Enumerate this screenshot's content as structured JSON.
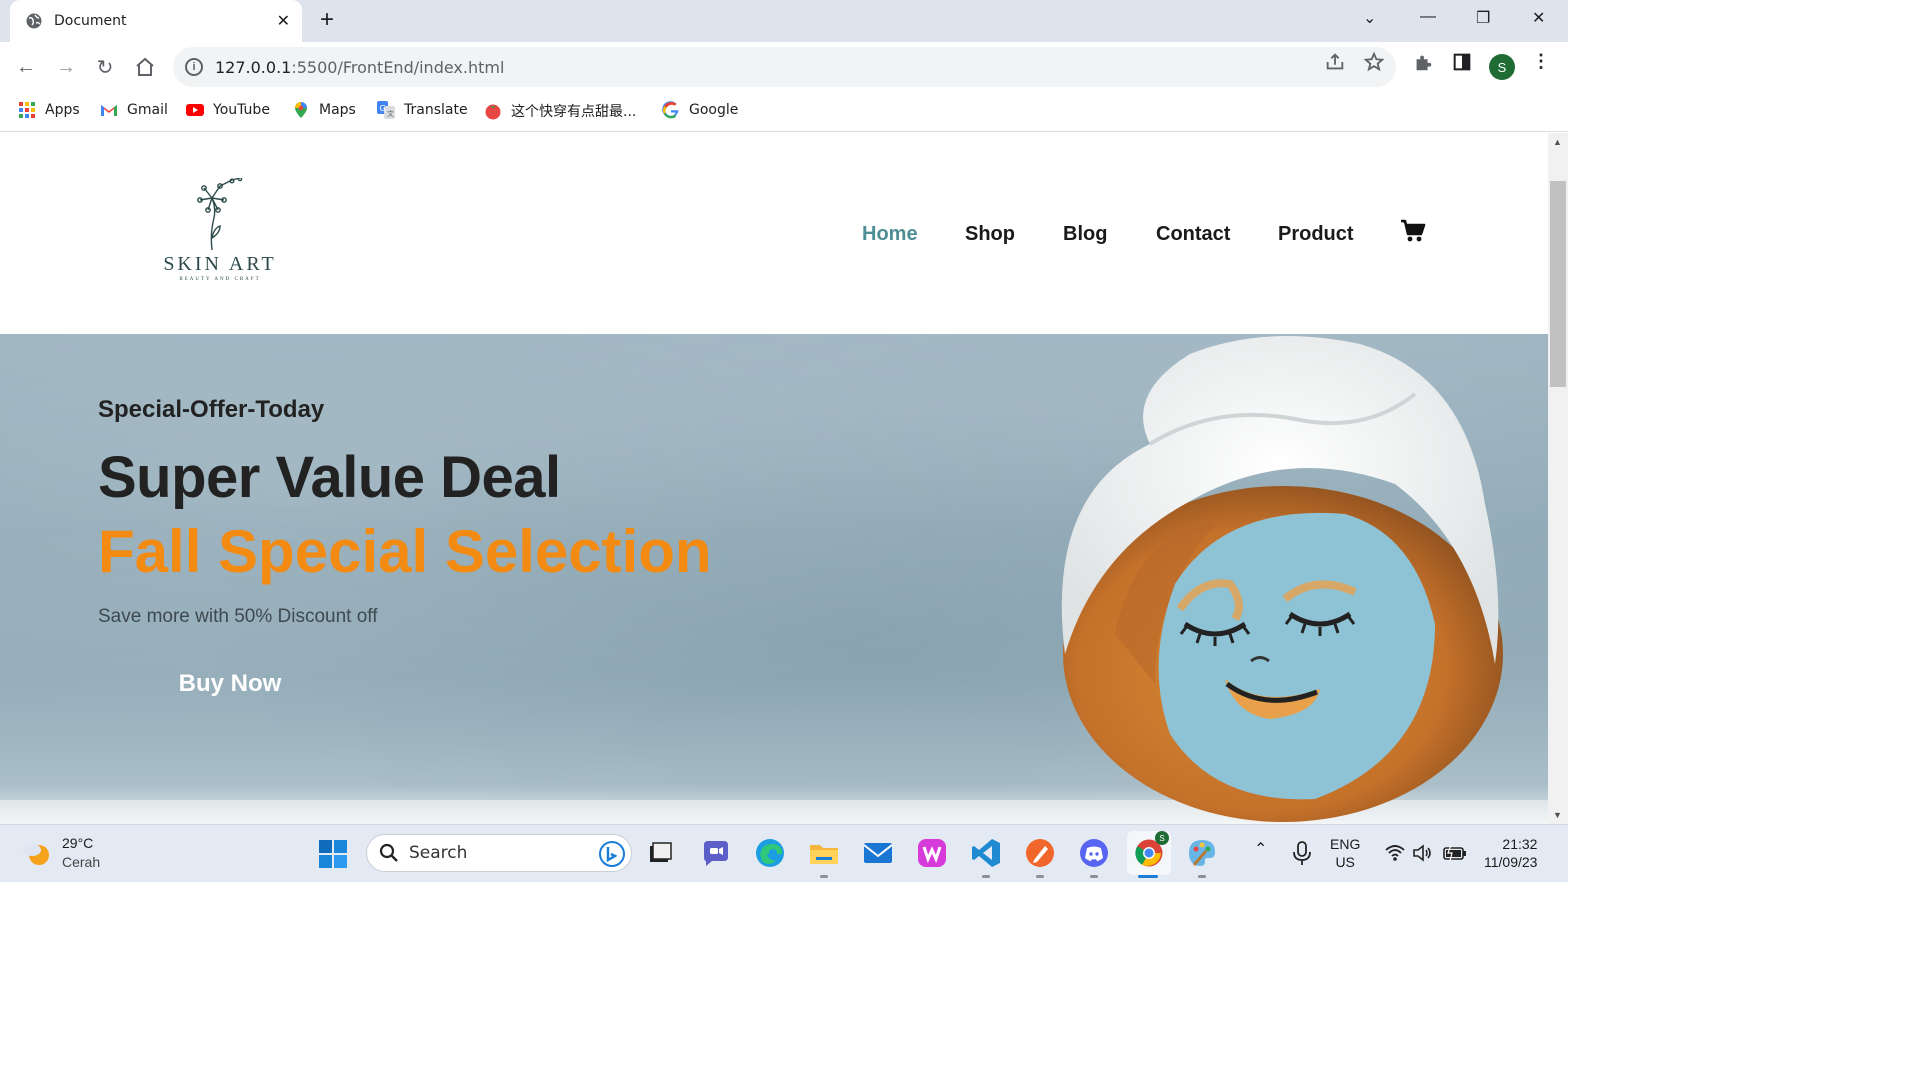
{
  "browser": {
    "tab_title": "Document",
    "url_host": "127.0.0.1",
    "url_rest": ":5500/FrontEnd/index.html",
    "profile_initial": "S",
    "bookmarks": [
      {
        "label": "Apps",
        "icon": "apps-grid-icon"
      },
      {
        "label": "Gmail",
        "icon": "gmail-icon"
      },
      {
        "label": "YouTube",
        "icon": "youtube-icon"
      },
      {
        "label": "Maps",
        "icon": "maps-icon"
      },
      {
        "label": "Translate",
        "icon": "translate-icon"
      },
      {
        "label": "这个快穿有点甜最...",
        "icon": "tomato-icon"
      },
      {
        "label": "Google",
        "icon": "google-icon"
      }
    ]
  },
  "site": {
    "logo_brand": "SKIN ART",
    "logo_tagline": "BEAUTY AND CRAFT",
    "nav": [
      "Home",
      "Shop",
      "Blog",
      "Contact",
      "Product"
    ],
    "active_nav": "Home",
    "colors": {
      "accent": "#4e8f95",
      "highlight": "#f38a12"
    }
  },
  "hero": {
    "offer": "Special-Offer-Today",
    "headline": "Super Value Deal",
    "highlight": "Fall Special Selection",
    "subtext": "Save more with 50% Discount off",
    "cta": "Buy Now"
  },
  "taskbar": {
    "temperature": "29°C",
    "condition": "Cerah",
    "search_placeholder": "Search",
    "language_top": "ENG",
    "language_bottom": "US",
    "time": "21:32",
    "date": "11/09/23",
    "chrome_badge": "S"
  }
}
